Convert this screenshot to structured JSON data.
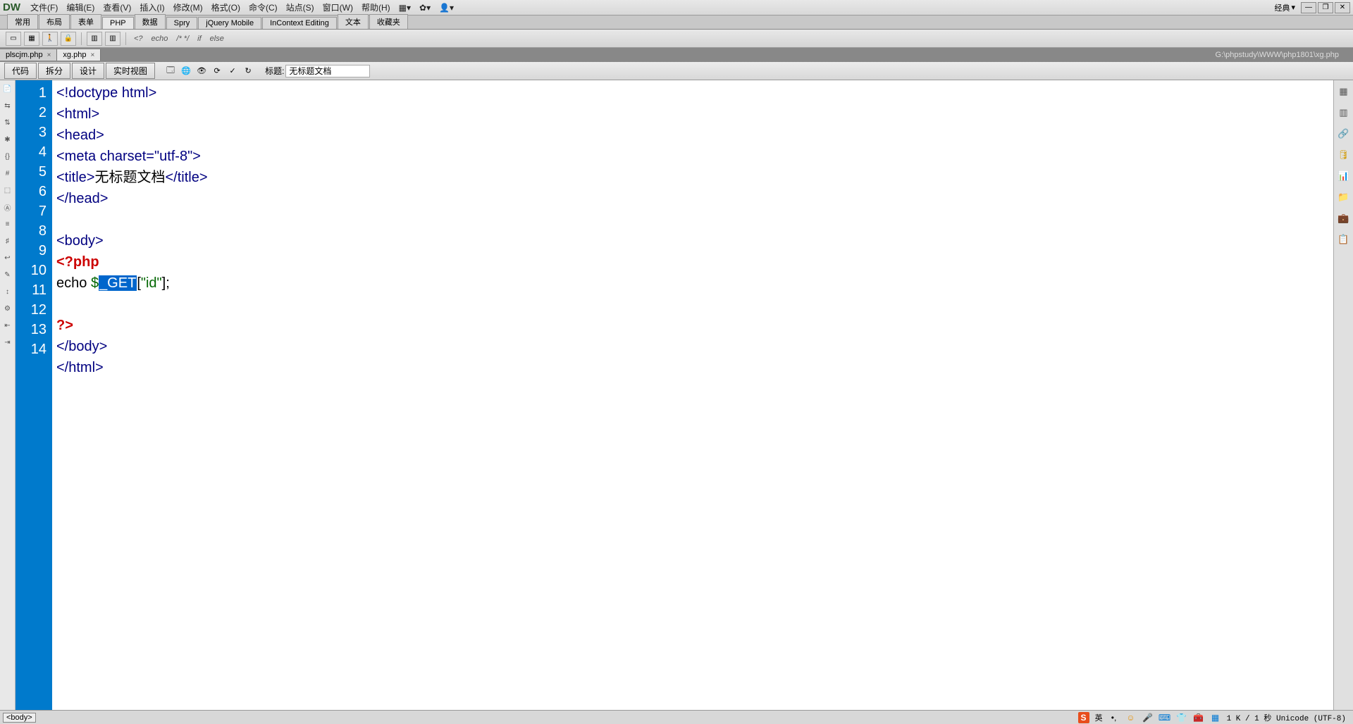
{
  "app": {
    "logo": "DW",
    "layout_label": "经典"
  },
  "menu": {
    "file": "文件(F)",
    "edit": "编辑(E)",
    "view": "查看(V)",
    "insert": "插入(I)",
    "modify": "修改(M)",
    "format": "格式(O)",
    "command": "命令(C)",
    "site": "站点(S)",
    "window": "窗口(W)",
    "help": "帮助(H)"
  },
  "win_btns": {
    "min": "—",
    "restore": "❐",
    "close": "✕"
  },
  "insert_tabs": {
    "common": "常用",
    "layout": "布局",
    "form": "表单",
    "php": "PHP",
    "data": "数据",
    "spry": "Spry",
    "jqm": "jQuery Mobile",
    "ice": "InContext Editing",
    "text": "文本",
    "fav": "收藏夹"
  },
  "toolbar2": {
    "echo": "echo",
    "if": "if",
    "else": "else",
    "php_open": "<?"
  },
  "doc_tabs": {
    "t1": "plscjm.php",
    "t1_close": "×",
    "t2": "xg.php",
    "t2_close": "×",
    "path": "G:\\phpstudy\\WWW\\php1801\\xg.php"
  },
  "view_bar": {
    "code": "代码",
    "split": "拆分",
    "design": "设计",
    "live": "实时视图",
    "title_label": "标题:",
    "title_value": "无标题文档"
  },
  "line_numbers": [
    "1",
    "2",
    "3",
    "4",
    "5",
    "6",
    "7",
    "8",
    "9",
    "10",
    "11",
    "12",
    "13",
    "14"
  ],
  "code": {
    "l1": "<!doctype html>",
    "l2": "<html>",
    "l3": "<head>",
    "l4": "<meta charset=\"utf-8\">",
    "l5_open": "<title>",
    "l5_text": "无标题文档",
    "l5_close": "</title>",
    "l6": "</head>",
    "l7": "",
    "l8": "<body>",
    "l9": "<?php",
    "l10_echo": "echo ",
    "l10_dollar": "$",
    "l10_get": "_GET",
    "l10_br1": "[",
    "l10_str": "\"id\"",
    "l10_br2": "];",
    "l11": "",
    "l12": "?>",
    "l13": "</body>",
    "l14": "</html>"
  },
  "status": {
    "tag": "<body>",
    "ime_s": "S",
    "ime_lang": "英",
    "encoding": "1 K / 1 秒 Unicode (UTF-8)"
  }
}
